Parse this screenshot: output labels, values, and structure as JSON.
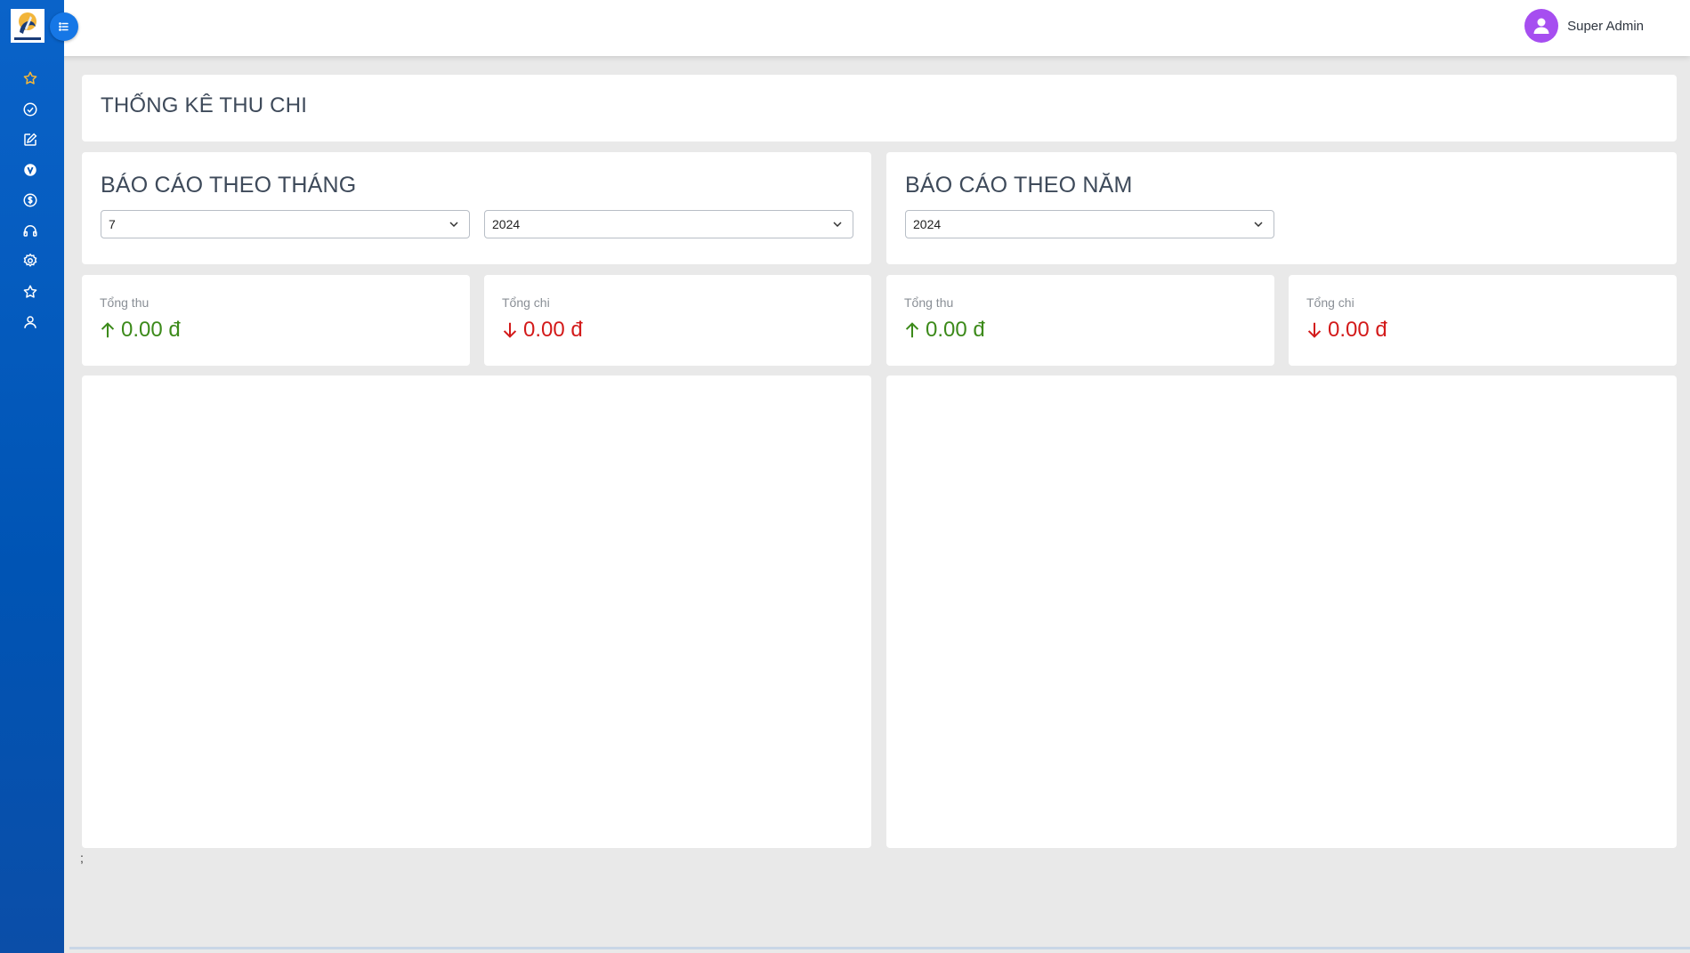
{
  "header": {
    "user_name": "Super Admin",
    "avatar_icon": "user-avatar-icon",
    "menu_toggle_icon": "list-menu-icon"
  },
  "sidebar": {
    "items": [
      {
        "icon": "star-icon",
        "color": "#f4b73a"
      },
      {
        "icon": "check-circle-icon"
      },
      {
        "icon": "edit-icon"
      },
      {
        "icon": "v-badge-icon"
      },
      {
        "icon": "dollar-circle-icon"
      },
      {
        "icon": "headphones-icon"
      },
      {
        "icon": "gear-icon"
      },
      {
        "icon": "star-outline-icon"
      },
      {
        "icon": "user-icon"
      }
    ]
  },
  "page": {
    "title": "THỐNG KÊ THU CHI"
  },
  "monthly": {
    "title": "BÁO CÁO THEO THÁNG",
    "month_value": "7",
    "year_value": "2024",
    "income_label": "Tổng thu",
    "income_value": "0.00 đ",
    "expense_label": "Tổng chi",
    "expense_value": "0.00 đ"
  },
  "yearly": {
    "title": "BÁO CÁO THEO NĂM",
    "year_value": "2024",
    "income_label": "Tổng thu",
    "income_value": "0.00 đ",
    "expense_label": "Tổng chi",
    "expense_value": "0.00 đ"
  },
  "footer": {
    "stray_text": ";"
  },
  "colors": {
    "sidebar": "#0054b4",
    "accent": "#1677e6",
    "income": "#3c8a1a",
    "expense": "#d31a1a",
    "avatar": "#a64ef0"
  }
}
